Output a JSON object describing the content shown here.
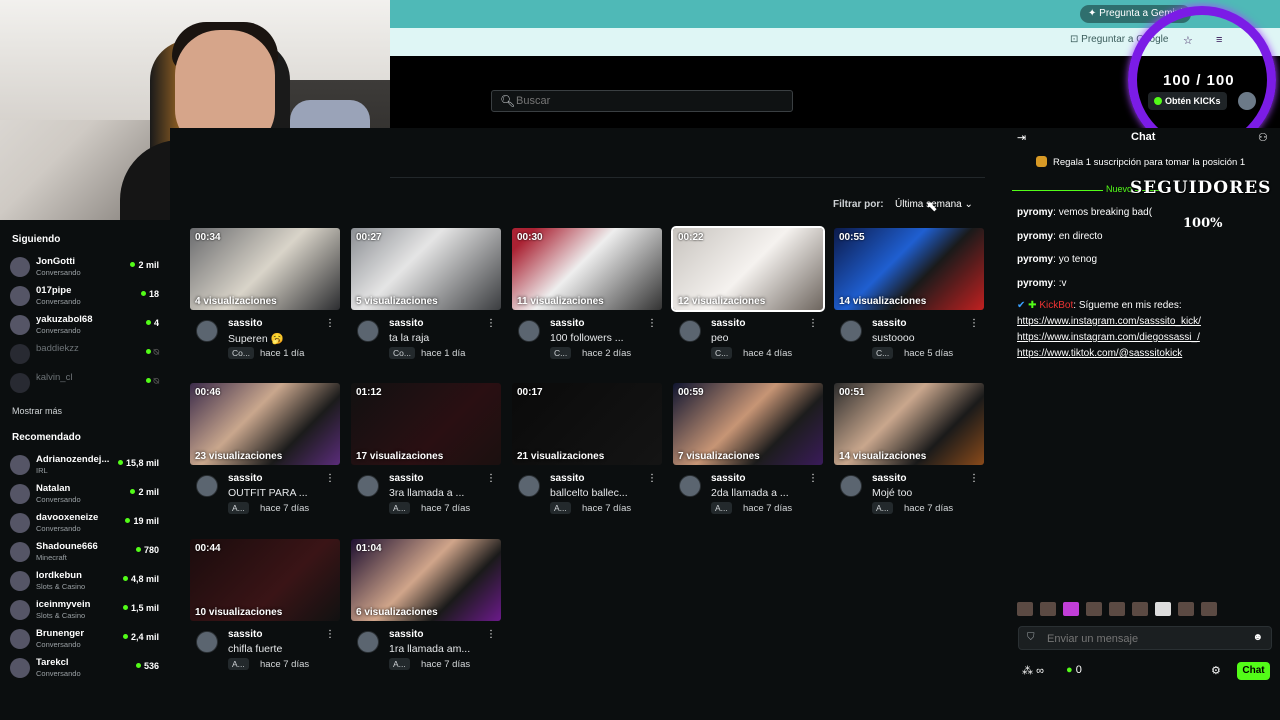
{
  "browser": {
    "gemini_label": "Pregunta a Gemini",
    "url_snippet": "Preguntar a Google"
  },
  "header": {
    "search_placeholder": "Buscar",
    "get_kicks_label": "Obtén KICKs",
    "goal_counter": "100 / 100"
  },
  "sidebar": {
    "following_title": "Siguiendo",
    "following": [
      {
        "name": "JonGotti",
        "sub": "Conversando",
        "count": "2 mil",
        "live": true
      },
      {
        "name": "017pipe",
        "sub": "Conversando",
        "count": "18",
        "live": true
      },
      {
        "name": "yakuzabol68",
        "sub": "Conversando",
        "count": "4",
        "live": true
      },
      {
        "name": "baddiekzz",
        "sub": "",
        "count": "",
        "live": false
      },
      {
        "name": "kalvin_cl",
        "sub": "",
        "count": "",
        "live": false
      }
    ],
    "show_more": "Mostrar más",
    "recommended_title": "Recomendado",
    "recommended": [
      {
        "name": "Adrianozendej...",
        "sub": "IRL",
        "count": "15,8 mil"
      },
      {
        "name": "Natalan",
        "sub": "Conversando",
        "count": "2 mil"
      },
      {
        "name": "davooxeneize",
        "sub": "Conversando",
        "count": "19 mil"
      },
      {
        "name": "Shadoune666",
        "sub": "Minecraft",
        "count": "780"
      },
      {
        "name": "lordkebun",
        "sub": "Slots & Casino",
        "count": "4,8 mil"
      },
      {
        "name": "iceinmyvein",
        "sub": "Slots & Casino",
        "count": "1,5 mil"
      },
      {
        "name": "Brunenger",
        "sub": "Conversando",
        "count": "2,4 mil"
      },
      {
        "name": "Tarekcl",
        "sub": "Conversando",
        "count": "536"
      }
    ]
  },
  "filter": {
    "label": "Filtrar por:",
    "value": "Última semana"
  },
  "clips": [
    {
      "duration": "00:34",
      "views": "4 visualizaciones",
      "channel": "sassito",
      "title": "Superen 🥱",
      "tag": "Co...",
      "ago": "hace 1 día"
    },
    {
      "duration": "00:27",
      "views": "5 visualizaciones",
      "channel": "sassito",
      "title": "ta la raja",
      "tag": "Co...",
      "ago": "hace 1 día"
    },
    {
      "duration": "00:30",
      "views": "11 visualizaciones",
      "channel": "sassito",
      "title": "100 followers ...",
      "tag": "C...",
      "ago": "hace 2 días"
    },
    {
      "duration": "00:22",
      "views": "12 visualizaciones",
      "channel": "sassito",
      "title": "peo",
      "tag": "C...",
      "ago": "hace 4 días"
    },
    {
      "duration": "00:55",
      "views": "14 visualizaciones",
      "channel": "sassito",
      "title": "sustoooo",
      "tag": "C...",
      "ago": "hace 5 días"
    },
    {
      "duration": "00:46",
      "views": "23 visualizaciones",
      "channel": "sassito",
      "title": "OUTFIT PARA ...",
      "tag": "A...",
      "ago": "hace 7 días"
    },
    {
      "duration": "01:12",
      "views": "17 visualizaciones",
      "channel": "sassito",
      "title": "3ra llamada a ...",
      "tag": "A...",
      "ago": "hace 7 días"
    },
    {
      "duration": "00:17",
      "views": "21 visualizaciones",
      "channel": "sassito",
      "title": "ballcelto ballec...",
      "tag": "A...",
      "ago": "hace 7 días"
    },
    {
      "duration": "00:59",
      "views": "7 visualizaciones",
      "channel": "sassito",
      "title": "2da llamada a ...",
      "tag": "A...",
      "ago": "hace 7 días"
    },
    {
      "duration": "00:51",
      "views": "14 visualizaciones",
      "channel": "sassito",
      "title": "Mojé too",
      "tag": "A...",
      "ago": "hace 7 días"
    },
    {
      "duration": "00:44",
      "views": "10 visualizaciones",
      "channel": "sassito",
      "title": "chifla fuerte",
      "tag": "A...",
      "ago": "hace 7 días"
    },
    {
      "duration": "01:04",
      "views": "6 visualizaciones",
      "channel": "sassito",
      "title": "1ra llamada am...",
      "tag": "A...",
      "ago": "hace 7 días"
    }
  ],
  "chat": {
    "title": "Chat",
    "pinned": "Regala 1 suscripción para tomar la posición 1",
    "new_label": "Nuevo",
    "overlay_followers": "SEGUIDORES",
    "overlay_percent": "100%",
    "messages": [
      {
        "user": "pyromy",
        "text": "vemos breaking bad("
      },
      {
        "user": "pyromy",
        "text": "en directo"
      },
      {
        "user": "pyromy",
        "text": "yo tenog"
      },
      {
        "user": "pyromy",
        "text": ":v"
      }
    ],
    "bot_user": "KickBot",
    "bot_text": "Sígueme en mis redes:",
    "links": [
      "https://www.instagram.com/sasssito_kick/",
      "https://www.instagram.com/diegossassi_/",
      "https://www.tiktok.com/@sasssitokick"
    ],
    "input_placeholder": "Enviar un mensaje",
    "infinity": "∞",
    "kicks_balance": "0",
    "send_label": "Chat"
  },
  "colors": {
    "accent": "#53fc18",
    "ring": "#7b1ce6",
    "browser": "#4fb9b7"
  }
}
